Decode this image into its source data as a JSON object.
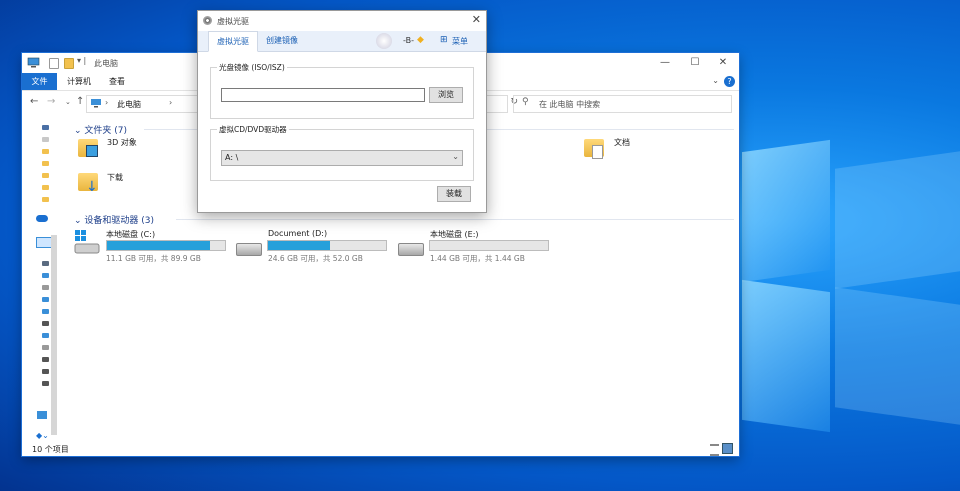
{
  "explorer": {
    "title": "此电脑",
    "ribbon_tabs": [
      "文件",
      "计算机",
      "查看"
    ],
    "address_path": "此电脑",
    "search_placeholder": "在 此电脑 中搜索",
    "folders_header": "文件夹 (7)",
    "folders": [
      {
        "name": "3D 对象",
        "icon": "3d-objects-icon"
      },
      {
        "name": "下载",
        "icon": "download-folder-icon"
      },
      {
        "name": "文档",
        "icon": "documents-folder-icon"
      }
    ],
    "drives_header": "设备和驱动器 (3)",
    "drives": [
      {
        "name": "本地磁盘 (C:)",
        "info": "11.1 GB 可用，共 89.9 GB",
        "used_fraction": 0.877,
        "icon": "windows-drive-icon"
      },
      {
        "name": "Document (D:)",
        "info": "24.6 GB 可用，共 52.0 GB",
        "used_fraction": 0.527,
        "icon": "hard-drive-icon"
      },
      {
        "name": "本地磁盘 (E:)",
        "info": "1.44 GB 可用，共 1.44 GB",
        "used_fraction": 0.0,
        "icon": "hard-drive-icon"
      }
    ],
    "status": "10 个项目",
    "window_buttons": [
      "—",
      "☐",
      "✕"
    ]
  },
  "dialog": {
    "title": "虚拟光驱",
    "tabs": [
      "虚拟光驱",
      "创建镜像"
    ],
    "user_label": "-B-",
    "menu_label": "菜单",
    "iso_group_label": "光盘镜像 (ISO/ISZ)",
    "iso_path": "",
    "browse_label": "浏览",
    "drive_group_label": "虚拟CD/DVD驱动器",
    "drive_value": "A: \\",
    "mount_label": "装载"
  },
  "colors": {
    "accent": "#1a6fd0",
    "drive_fill": "#26a0da",
    "folder": "#f2c14e"
  }
}
